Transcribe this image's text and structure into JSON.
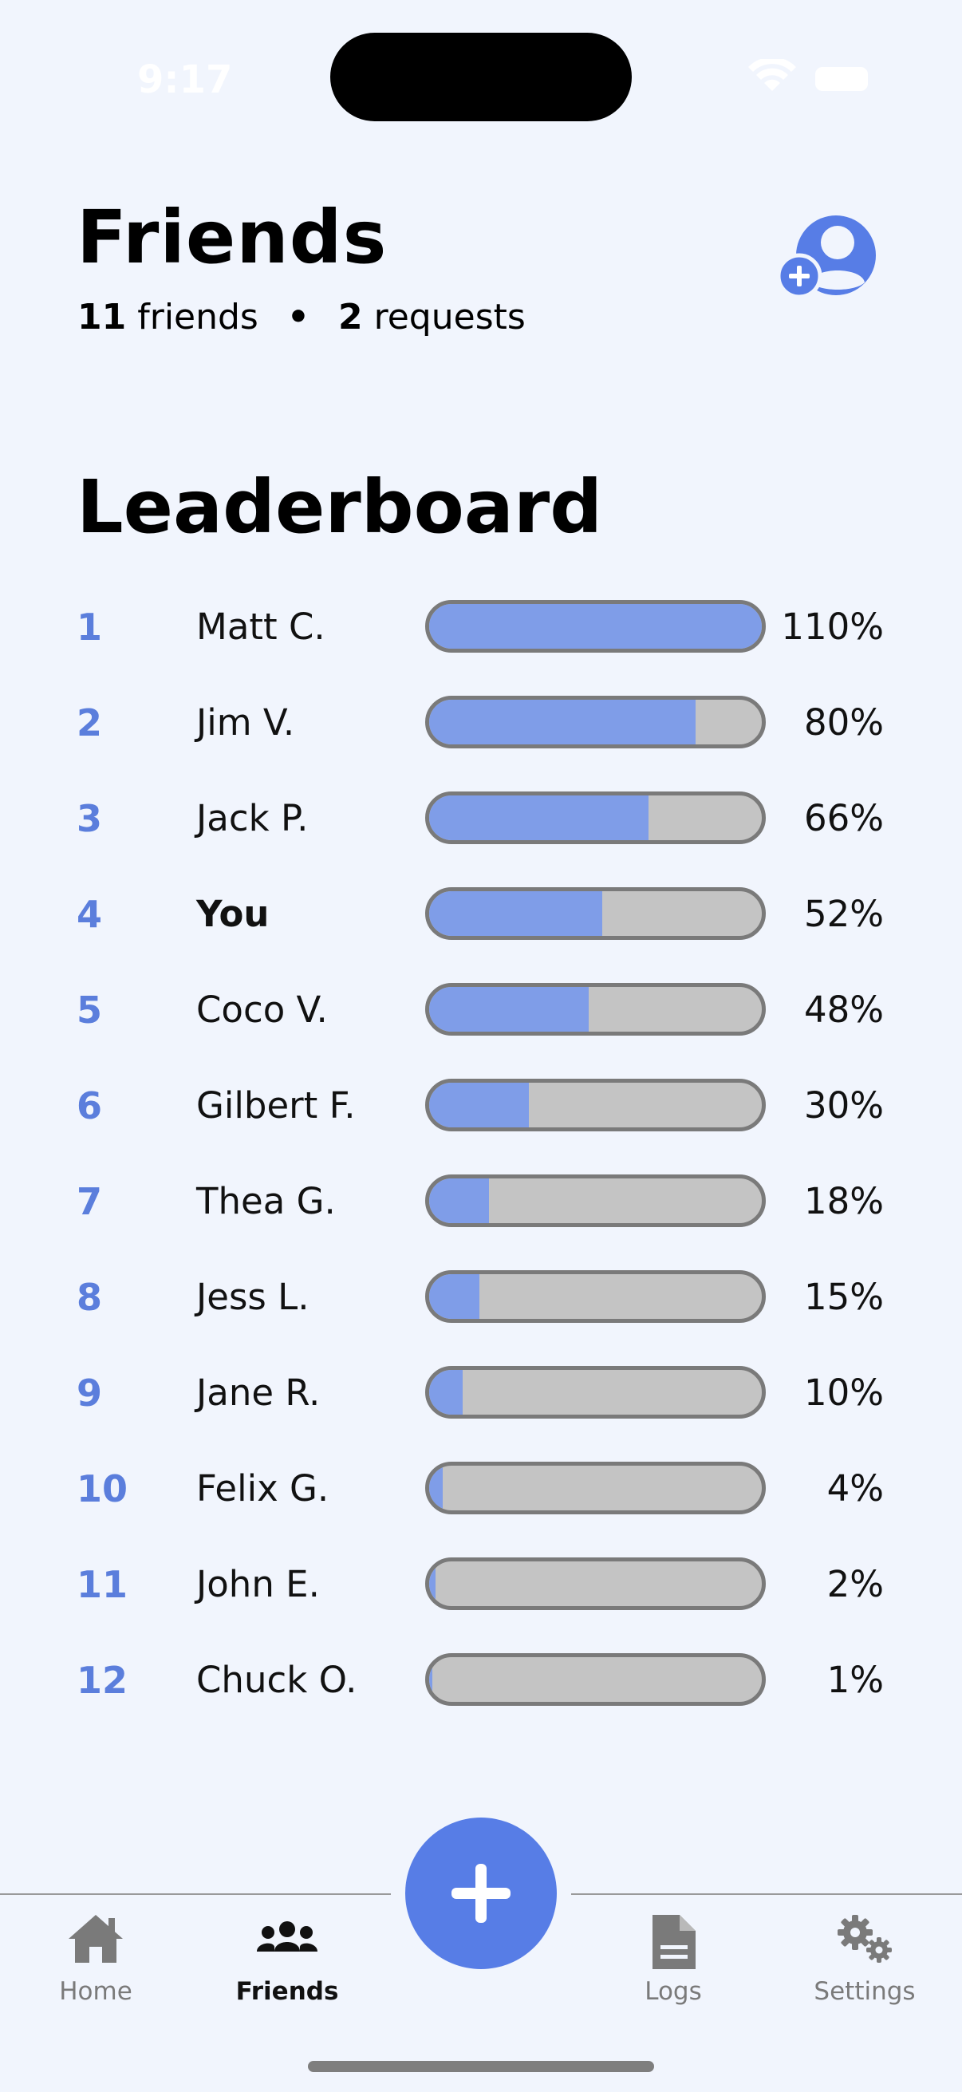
{
  "status_bar": {
    "time": "9:17"
  },
  "header": {
    "title": "Friends",
    "friends_count": "11",
    "friends_label": "friends",
    "requests_count": "2",
    "requests_label": "requests",
    "separator": "•",
    "add_friend_icon": "add-person-icon"
  },
  "leaderboard": {
    "title": "Leaderboard",
    "rows": [
      {
        "rank": "1",
        "name": "Matt C.",
        "percent": "110%",
        "fill": 1.0
      },
      {
        "rank": "2",
        "name": "Jim V.",
        "percent": "80%",
        "fill": 0.8
      },
      {
        "rank": "3",
        "name": "Jack P.",
        "percent": "66%",
        "fill": 0.66
      },
      {
        "rank": "4",
        "name": "You",
        "percent": "52%",
        "fill": 0.52,
        "is_me": true
      },
      {
        "rank": "5",
        "name": "Coco V.",
        "percent": "48%",
        "fill": 0.48
      },
      {
        "rank": "6",
        "name": "Gilbert F.",
        "percent": "30%",
        "fill": 0.3
      },
      {
        "rank": "7",
        "name": "Thea G.",
        "percent": "18%",
        "fill": 0.18
      },
      {
        "rank": "8",
        "name": "Jess L.",
        "percent": "15%",
        "fill": 0.15
      },
      {
        "rank": "9",
        "name": "Jane R.",
        "percent": "10%",
        "fill": 0.1
      },
      {
        "rank": "10",
        "name": "Felix G.",
        "percent": "4%",
        "fill": 0.04
      },
      {
        "rank": "11",
        "name": "John E.",
        "percent": "2%",
        "fill": 0.02
      },
      {
        "rank": "12",
        "name": "Chuck O.",
        "percent": "1%",
        "fill": 0.01
      }
    ]
  },
  "nav": {
    "items": [
      {
        "label": "Home",
        "icon": "home-icon"
      },
      {
        "label": "Friends",
        "icon": "friends-icon",
        "active": true
      },
      {
        "label": "Logs",
        "icon": "logs-icon"
      },
      {
        "label": "Settings",
        "icon": "gear-icon"
      }
    ],
    "fab_icon": "plus-icon"
  },
  "colors": {
    "background": "#f1f5fd",
    "accent": "#577de6",
    "rank": "#5b7edc",
    "bar_fill": "#7f9de8",
    "bar_track": "#c4c4c4",
    "bar_border": "#7a7a7a"
  }
}
